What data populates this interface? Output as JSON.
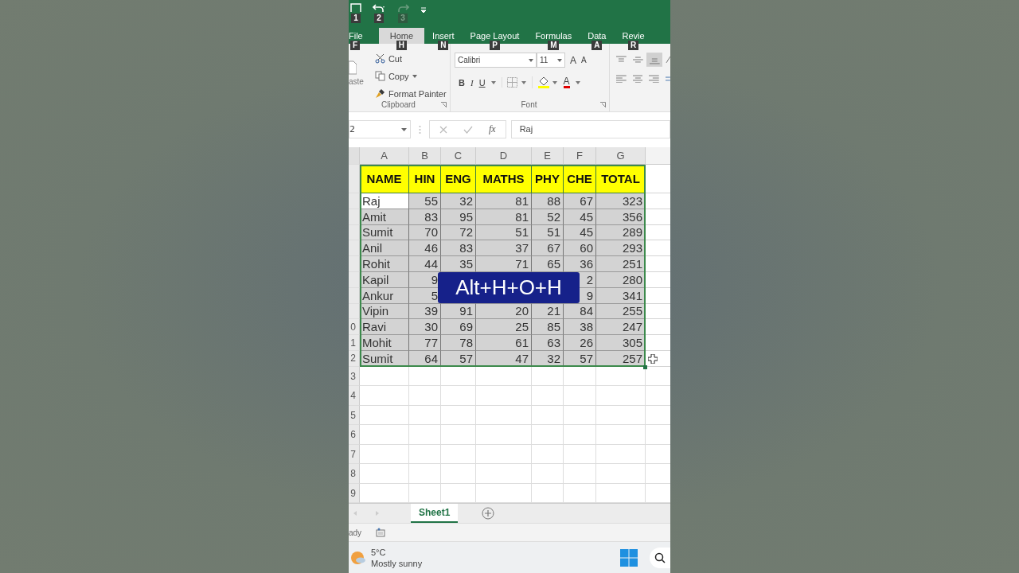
{
  "quick_access": [
    {
      "kind": "save",
      "keytip": "1",
      "disabled": false
    },
    {
      "kind": "undo",
      "keytip": "2",
      "disabled": false
    },
    {
      "kind": "redo",
      "keytip": "3",
      "disabled": true
    }
  ],
  "tabs": [
    {
      "label": "File",
      "keytip": "F",
      "selected": false
    },
    {
      "label": "Home",
      "keytip": "H",
      "selected": true
    },
    {
      "label": "Insert",
      "keytip": "N",
      "selected": false
    },
    {
      "label": "Page Layout",
      "keytip": "P",
      "selected": false
    },
    {
      "label": "Formulas",
      "keytip": "M",
      "selected": false
    },
    {
      "label": "Data",
      "keytip": "A",
      "selected": false
    },
    {
      "label": "Revie",
      "keytip": "R",
      "selected": false
    }
  ],
  "ribbon": {
    "clipboard": {
      "paste": "aste",
      "cut": "Cut",
      "copy": "Copy",
      "format_painter": "Format Painter",
      "label": "Clipboard"
    },
    "font": {
      "name": "Calibri",
      "size": "11",
      "grow": "A",
      "shrink": "A",
      "bold": "B",
      "italic": "I",
      "underline": "U",
      "font_color": "A",
      "label": "Font"
    }
  },
  "formula_bar": {
    "name_box": "2",
    "fx": "fx",
    "value": "Raj"
  },
  "columns": [
    "A",
    "B",
    "C",
    "D",
    "E",
    "F",
    "G"
  ],
  "header_row": [
    "NAME",
    "HIN",
    "ENG",
    "MATHS",
    "PHY",
    "CHE",
    "TOTAL"
  ],
  "rows": [
    {
      "active_cell": true,
      "cells": [
        "Raj",
        "55",
        "32",
        "81",
        "88",
        "67",
        "323"
      ]
    },
    {
      "active_cell": false,
      "cells": [
        "Amit",
        "83",
        "95",
        "81",
        "52",
        "45",
        "356"
      ]
    },
    {
      "active_cell": false,
      "cells": [
        "Sumit",
        "70",
        "72",
        "51",
        "51",
        "45",
        "289"
      ]
    },
    {
      "active_cell": false,
      "cells": [
        "Anil",
        "46",
        "83",
        "37",
        "67",
        "60",
        "293"
      ]
    },
    {
      "active_cell": false,
      "cells": [
        "Rohit",
        "44",
        "35",
        "71",
        "65",
        "36",
        "251"
      ]
    },
    {
      "active_cell": false,
      "cells": [
        "Kapil",
        "9",
        null,
        null,
        null,
        "2",
        "280"
      ]
    },
    {
      "active_cell": false,
      "cells": [
        "Ankur",
        "5",
        null,
        null,
        null,
        "9",
        "341"
      ]
    },
    {
      "active_cell": false,
      "cells": [
        "Vipin",
        "39",
        "91",
        "20",
        "21",
        "84",
        "255"
      ]
    },
    {
      "active_cell": false,
      "label": "0",
      "cells": [
        "Ravi",
        "30",
        "69",
        "25",
        "85",
        "38",
        "247"
      ]
    },
    {
      "active_cell": false,
      "label": "1",
      "cells": [
        "Mohit",
        "77",
        "78",
        "61",
        "63",
        "26",
        "305"
      ]
    },
    {
      "active_cell": false,
      "label": "2",
      "cells": [
        "Sumit",
        "64",
        "57",
        "47",
        "32",
        "57",
        "257"
      ]
    }
  ],
  "empty_rows": [
    "3",
    "4",
    "5",
    "6",
    "7",
    "8",
    "9"
  ],
  "sheet_tabs": [
    {
      "label": "Sheet1",
      "selected": true
    }
  ],
  "status": "ady",
  "overlay": "Alt+H+O+H",
  "taskbar": {
    "temperature": "5°C",
    "weather": "Mostly sunny"
  }
}
